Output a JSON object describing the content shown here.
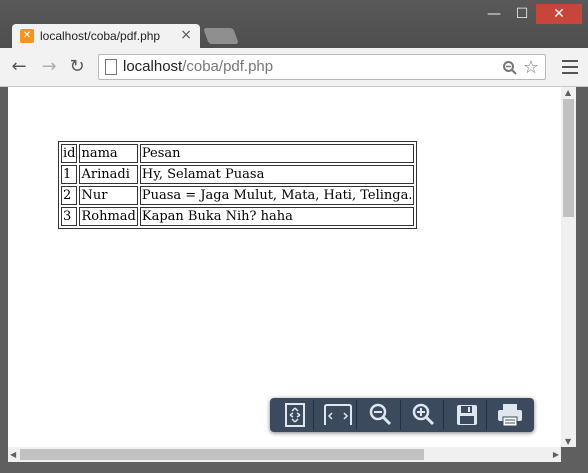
{
  "window": {
    "minimize_label": "—",
    "maximize_label": "☐",
    "close_label": "✕"
  },
  "tab": {
    "favicon_icon": "xampp-icon",
    "title": "localhost/coba/pdf.php",
    "close_label": "×"
  },
  "toolbar": {
    "back_icon": "←",
    "forward_icon": "→",
    "reload_icon": "↻",
    "url_host": "localhost",
    "url_path": "/coba/pdf.php",
    "zoom_icon": "🔍",
    "star_icon": "☆"
  },
  "table": {
    "header": [
      "id",
      "nama",
      "Pesan"
    ],
    "rows": [
      [
        "1",
        "Arinadi",
        "Hy, Selamat Puasa"
      ],
      [
        "2",
        "Nur",
        "Puasa = Jaga Mulut, Mata, Hati, Telinga."
      ],
      [
        "3",
        "Rohmad",
        "Kapan Buka Nih? haha"
      ]
    ]
  },
  "pdf_toolbar": {
    "buttons": [
      "fit-page-icon",
      "fit-width-icon",
      "zoom-out-icon",
      "zoom-in-icon",
      "save-icon",
      "print-icon"
    ],
    "accent": "#3b4a5c"
  }
}
